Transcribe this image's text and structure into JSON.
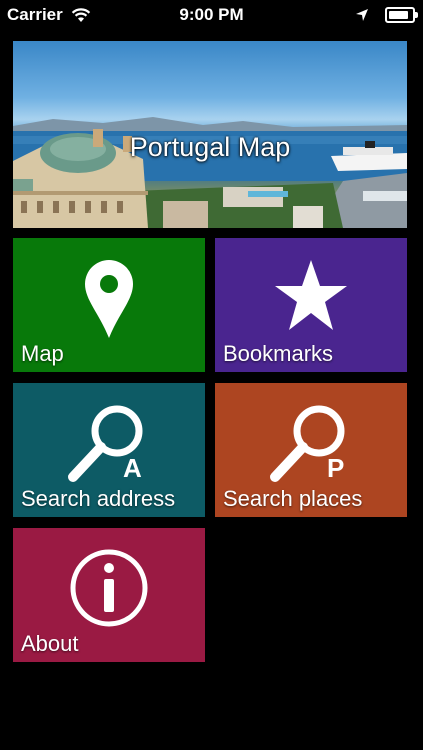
{
  "status_bar": {
    "carrier": "Carrier",
    "time": "9:00 PM",
    "battery_level": 0.85,
    "icons": [
      "wifi-icon",
      "location-arrow-icon",
      "battery-icon"
    ]
  },
  "hero": {
    "title": "Portugal Map"
  },
  "tiles": [
    {
      "label": "Map",
      "icon": "map-pin-icon",
      "color": "#08790a"
    },
    {
      "label": "Bookmarks",
      "icon": "star-icon",
      "color": "#4a258f"
    },
    {
      "label": "Search address",
      "icon": "search-address-icon",
      "icon_letter": "A",
      "color": "#0d5b65"
    },
    {
      "label": "Search places",
      "icon": "search-places-icon",
      "icon_letter": "P",
      "color": "#ad4521"
    },
    {
      "label": "About",
      "icon": "info-icon",
      "color": "#9a1a43"
    }
  ]
}
